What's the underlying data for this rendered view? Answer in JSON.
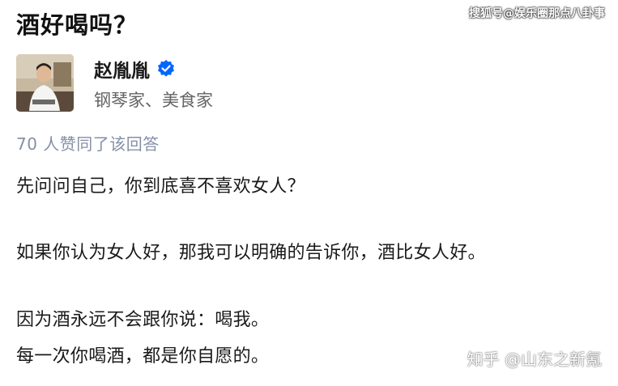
{
  "question": {
    "title": "酒好喝吗？"
  },
  "watermarks": {
    "top": "搜狐号@娱乐圈那点八卦事",
    "bottom": "知乎 @山东之新氪"
  },
  "author": {
    "name": "赵胤胤",
    "headline": "钢琴家、美食家",
    "verified_icon": "verified-badge-icon",
    "verified_color": "#0066ff"
  },
  "answer": {
    "vote_text": "70 人赞同了该回答",
    "paragraphs": [
      "先问问自己，你到底喜不喜欢女人？",
      "如果你认为女人好，那我可以明确的告诉你，酒比女人好。",
      "因为酒永远不会跟你说：喝我。",
      "每一次你喝酒，都是你自愿的。"
    ]
  }
}
